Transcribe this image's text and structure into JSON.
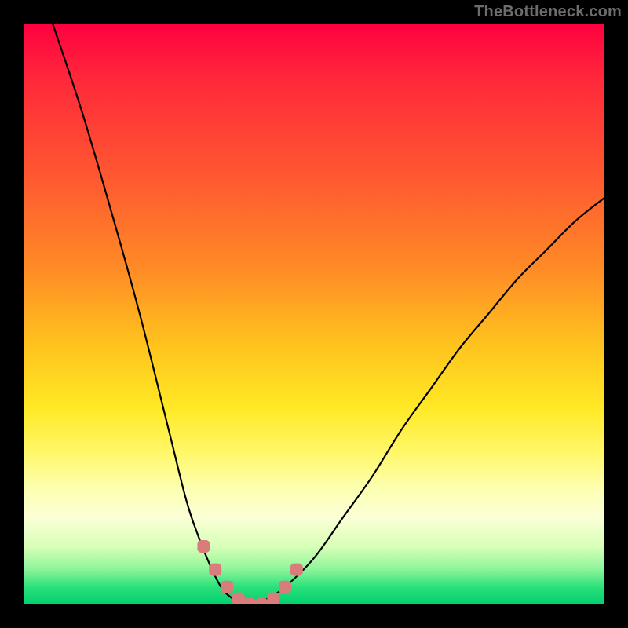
{
  "watermark": "TheBottleneck.com",
  "colors": {
    "frame": "#000000",
    "curve": "#000000",
    "marker": "#d97c7c"
  },
  "chart_data": {
    "type": "line",
    "title": "",
    "xlabel": "",
    "ylabel": "",
    "xlim": [
      0,
      100
    ],
    "ylim": [
      0,
      100
    ],
    "grid": false,
    "legend": false,
    "series": [
      {
        "name": "bottleneck-curve",
        "x": [
          5,
          10,
          15,
          20,
          25,
          28,
          30,
          32,
          34,
          36,
          38,
          40,
          42,
          45,
          50,
          55,
          60,
          65,
          70,
          75,
          80,
          85,
          90,
          95,
          100
        ],
        "y": [
          100,
          85,
          68,
          50,
          30,
          18,
          12,
          7,
          3,
          1,
          0,
          0,
          1,
          3,
          8,
          15,
          22,
          30,
          37,
          44,
          50,
          56,
          61,
          66,
          70
        ]
      }
    ],
    "markers": {
      "name": "highlight-dots",
      "x": [
        31,
        33,
        35,
        37,
        39,
        41,
        43,
        45,
        47
      ],
      "y": [
        10,
        6,
        3,
        1,
        0,
        0,
        1,
        3,
        6
      ]
    }
  }
}
